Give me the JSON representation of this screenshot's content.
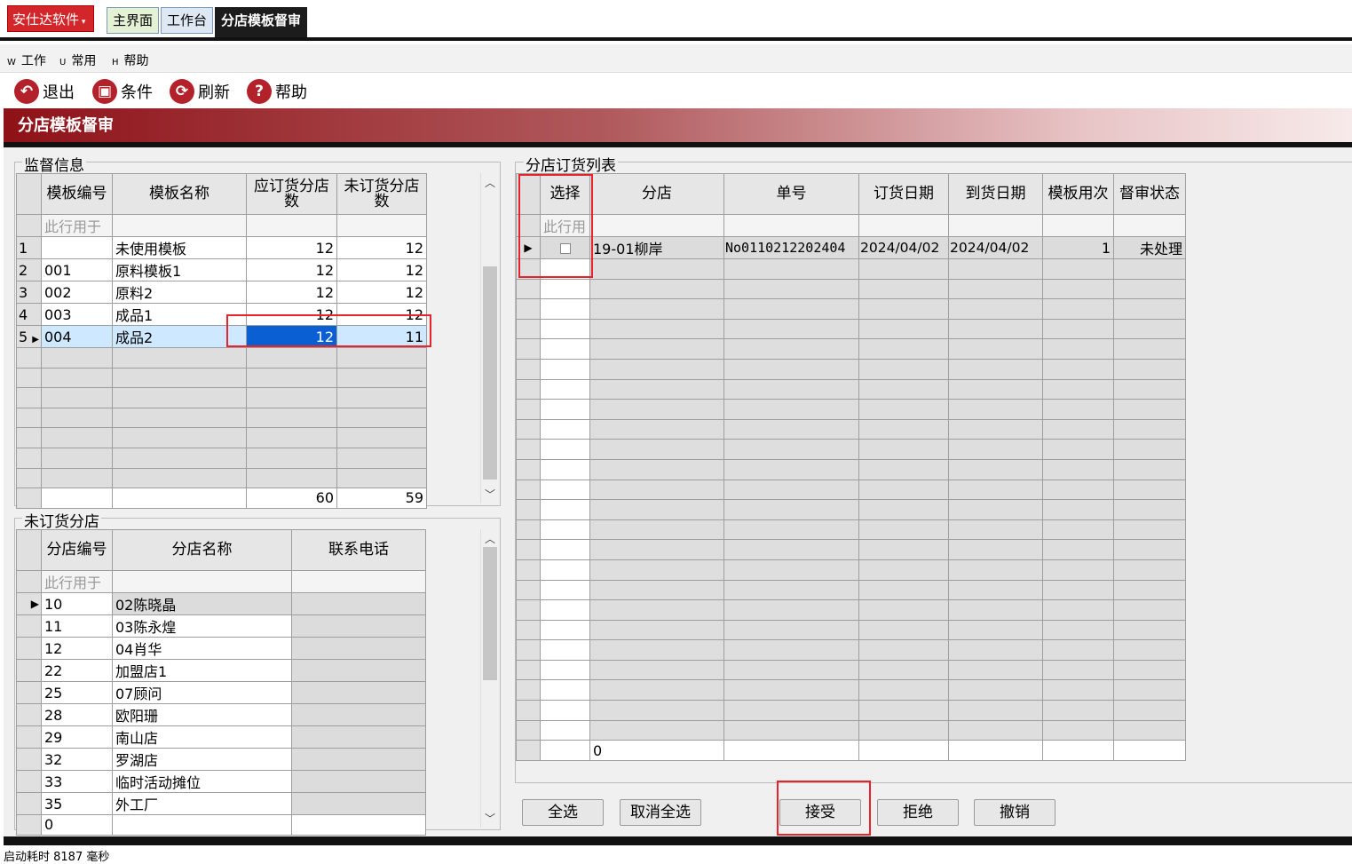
{
  "app": {
    "menu_button": "安仕达软件"
  },
  "tabs": [
    {
      "label": "主界面"
    },
    {
      "label": "工作台"
    },
    {
      "label": "分店模板督审"
    }
  ],
  "menubar": [
    {
      "key": "W",
      "label": "工作"
    },
    {
      "key": "U",
      "label": "常用"
    },
    {
      "key": "H",
      "label": "帮助"
    }
  ],
  "toolbar": {
    "exit": "退出",
    "condition": "条件",
    "refresh": "刷新",
    "help": "帮助"
  },
  "page_title": "分店模板督审",
  "supervision": {
    "group_label": "监督信息",
    "columns": [
      "模板编号",
      "模板名称",
      "应订货分店数",
      "未订货分店数"
    ],
    "filter_text": "此行用于",
    "rows": [
      {
        "idx": "1",
        "code": "",
        "name": "未使用模板",
        "should": "12",
        "not": "12"
      },
      {
        "idx": "2",
        "code": "001",
        "name": "原料模板1",
        "should": "12",
        "not": "12"
      },
      {
        "idx": "3",
        "code": "002",
        "name": "原料2",
        "should": "12",
        "not": "12"
      },
      {
        "idx": "4",
        "code": "003",
        "name": "成品1",
        "should": "12",
        "not": "12"
      },
      {
        "idx": "5",
        "code": "004",
        "name": "成品2",
        "should": "12",
        "not": "11"
      }
    ],
    "totals": {
      "should": "60",
      "not": "59"
    }
  },
  "unordered": {
    "group_label": "未订货分店",
    "columns": [
      "分店编号",
      "分店名称",
      "联系电话"
    ],
    "filter_text": "此行用于",
    "rows": [
      {
        "code": "10",
        "name": "02陈晓晶",
        "phone": ""
      },
      {
        "code": "11",
        "name": "03陈永煌",
        "phone": ""
      },
      {
        "code": "12",
        "name": "04肖华",
        "phone": ""
      },
      {
        "code": "22",
        "name": "加盟店1",
        "phone": ""
      },
      {
        "code": "25",
        "name": "07顾问",
        "phone": ""
      },
      {
        "code": "28",
        "name": "欧阳珊",
        "phone": ""
      },
      {
        "code": "29",
        "name": "南山店",
        "phone": ""
      },
      {
        "code": "32",
        "name": "罗湖店",
        "phone": ""
      },
      {
        "code": "33",
        "name": "临时活动摊位",
        "phone": ""
      },
      {
        "code": "35",
        "name": "外工厂",
        "phone": ""
      }
    ],
    "footer_count": "0"
  },
  "orders": {
    "group_label": "分店订货列表",
    "columns": [
      "选择",
      "分店",
      "单号",
      "订货日期",
      "到货日期",
      "模板用次",
      "督审状态"
    ],
    "filter_text": "此行用",
    "rows": [
      {
        "checked": false,
        "store": "19-01柳岸",
        "order_no": "No0110212202404",
        "order_date": "2024/04/02",
        "arrive_date": "2024/04/02",
        "uses": "1",
        "status": "未处理"
      }
    ],
    "footer_count": "0"
  },
  "buttons": {
    "select_all": "全选",
    "deselect_all": "取消全选",
    "accept": "接受",
    "reject": "拒绝",
    "revoke": "撤销"
  },
  "status_bar": "启动耗时 8187 毫秒"
}
